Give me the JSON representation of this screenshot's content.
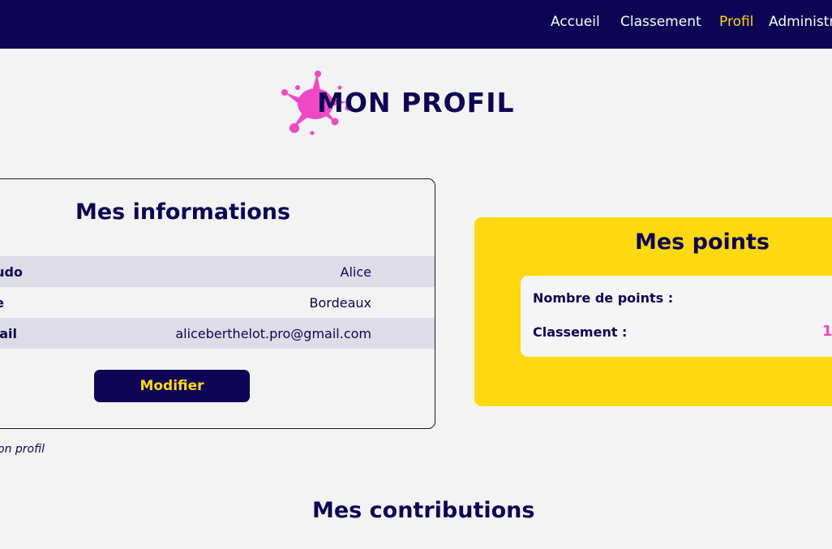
{
  "nav": {
    "items": [
      {
        "label": "Accueil",
        "active": false
      },
      {
        "label": "Classement",
        "active": false
      },
      {
        "label": "Profil",
        "active": true
      },
      {
        "label": "Administr",
        "active": false
      }
    ]
  },
  "page": {
    "title": "MON PROFIL",
    "splat_icon": "paint-splat-icon"
  },
  "info_card": {
    "title": "Mes informations",
    "rows": [
      {
        "label": "udo",
        "value": "Alice"
      },
      {
        "label": "e",
        "value": "Bordeaux"
      },
      {
        "label": "ail",
        "value": "aliceberthelot.pro@gmail.com"
      }
    ],
    "modify_label": "Modifier",
    "delete_link": "on profil"
  },
  "points_card": {
    "title": "Mes points",
    "points_label": "Nombre de points :",
    "ranking_label": "Classement :",
    "ranking_value": "1"
  },
  "contributions": {
    "title": "Mes contributions"
  },
  "colors": {
    "navy": "#0d0456",
    "yellow": "#ffd90f",
    "pink": "#f148c6",
    "background": "#f3f3f3",
    "row_shade": "#dedde7"
  }
}
